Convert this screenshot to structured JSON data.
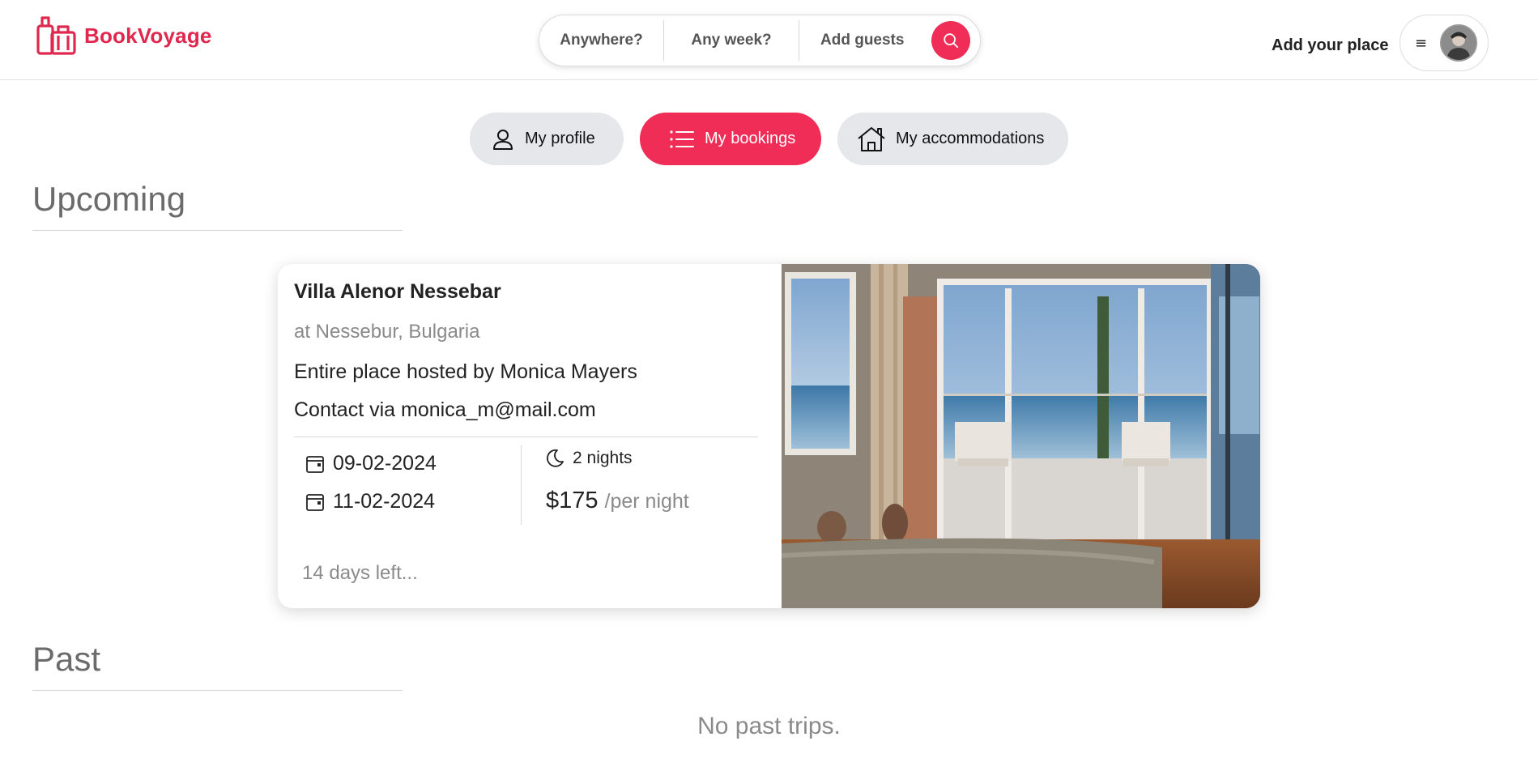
{
  "header": {
    "logo_text": "BookVoyage",
    "search": {
      "where": "Anywhere?",
      "when": "Any week?",
      "guests": "Add guests"
    },
    "add_place": "Add your place",
    "menu_glyph": "≡"
  },
  "nav": {
    "profile": "My profile",
    "bookings": "My bookings",
    "accommodations": "My accommodations",
    "active": "bookings"
  },
  "upcoming": {
    "title": "Upcoming",
    "bookings": [
      {
        "name": "Villa Alenor Nessebar",
        "location": "at Nessebur, Bulgaria",
        "host": "Entire place hosted by Monica Mayers",
        "contact": "Contact via monica_m@mail.com",
        "check_in": "09-02-2024",
        "check_out": "11-02-2024",
        "nights": "2 nights",
        "price": "$175",
        "price_unit": "/per night",
        "days_left": "14 days left..."
      }
    ]
  },
  "past": {
    "title": "Past",
    "empty": "No past trips."
  },
  "colors": {
    "brand": "#e0284f",
    "accent": "#ef2d56",
    "pill_inactive": "#e5e7eb",
    "muted_text": "#8a8a8a"
  },
  "icons": [
    "luggage-logo-icon",
    "search-icon",
    "menu-icon",
    "user-icon",
    "list-icon",
    "house-icon",
    "calendar-icon",
    "moon-icon"
  ]
}
